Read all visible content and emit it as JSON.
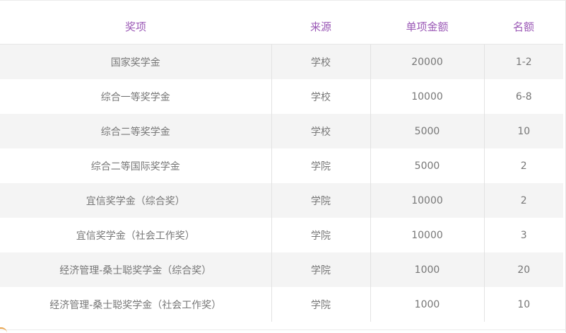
{
  "table": {
    "headers": [
      "奖项",
      "来源",
      "单项金额",
      "名额"
    ],
    "rows": [
      [
        "国家奖学金",
        "学校",
        "20000",
        "1-2"
      ],
      [
        "综合一等奖学金",
        "学校",
        "10000",
        "6-8"
      ],
      [
        "综合二等奖学金",
        "学校",
        "5000",
        "10"
      ],
      [
        "综合二等国际奖学金",
        "学院",
        "5000",
        "2"
      ],
      [
        "宜信奖学金（综合奖）",
        "学院",
        "10000",
        "2"
      ],
      [
        "宜信奖学金（社会工作奖）",
        "学院",
        "10000",
        "3"
      ],
      [
        "经济管理-桑士聪奖学金（综合奖）",
        "学院",
        "1000",
        "20"
      ],
      [
        "经济管理-桑士聪奖学金（社会工作奖）",
        "学院",
        "1000",
        "10"
      ]
    ]
  },
  "colors": {
    "header_text": "#9b59b6",
    "cell_text": "#777777",
    "stripe": "#f4f4f4"
  }
}
